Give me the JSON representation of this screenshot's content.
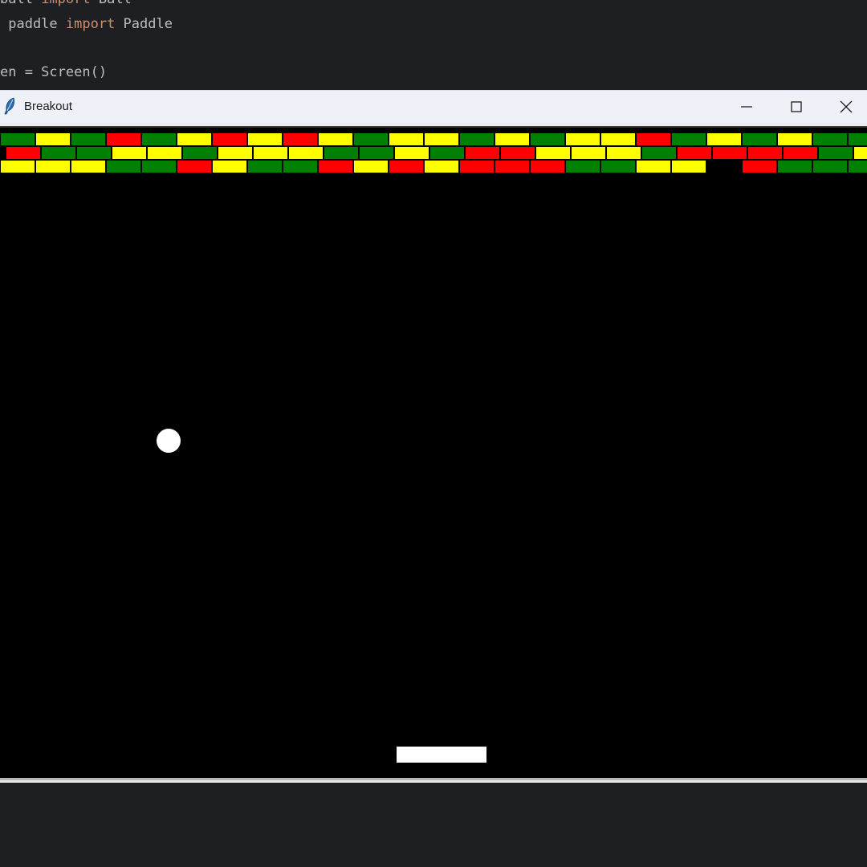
{
  "editor": {
    "lines": [
      {
        "parts": [
          {
            "text": "ball ",
            "kind": "plain"
          },
          {
            "text": "import",
            "kind": "keyword"
          },
          {
            "text": " Ball",
            "kind": "plain"
          }
        ]
      },
      {
        "parts": [
          {
            "text": " paddle ",
            "kind": "plain"
          },
          {
            "text": "import",
            "kind": "keyword"
          },
          {
            "text": " Paddle",
            "kind": "plain"
          }
        ]
      },
      {
        "parts": [
          {
            "text": "en = Screen()",
            "kind": "plain"
          }
        ]
      }
    ]
  },
  "window": {
    "title": "Breakout",
    "app_icon": "feather-icon",
    "buttons": [
      "minimize-icon",
      "maximize-icon",
      "close-icon"
    ]
  },
  "colors": {
    "green": "#008000",
    "yellow": "#ffff00",
    "red": "#ff0000",
    "canvas_bg": "#000000",
    "ball": "#ffffff",
    "paddle": "#ffffff",
    "brick_border": "#000000"
  },
  "game": {
    "brick_rows": [
      {
        "offset_half_brick": false,
        "bricks": [
          "G",
          "Y",
          "G",
          "R",
          "G",
          "Y",
          "R",
          "Y",
          "R",
          "Y",
          "G",
          "Y",
          "Y",
          "G",
          "Y",
          "G",
          "Y",
          "Y",
          "R",
          "G",
          "Y",
          "G",
          "Y",
          "G",
          "G"
        ]
      },
      {
        "offset_half_brick": true,
        "bricks": [
          "R",
          "G",
          "G",
          "Y",
          "Y",
          "G",
          "Y",
          "Y",
          "Y",
          "G",
          "G",
          "Y",
          "G",
          "R",
          "R",
          "Y",
          "Y",
          "Y",
          "G",
          "R",
          "R",
          "R",
          "R",
          "G",
          "Y"
        ]
      },
      {
        "offset_half_brick": false,
        "bricks": [
          "Y",
          "Y",
          "Y",
          "G",
          "G",
          "R",
          "Y",
          "G",
          "G",
          "R",
          "Y",
          "R",
          "Y",
          "R",
          "R",
          "R",
          "G",
          "G",
          "Y",
          "Y",
          null,
          "R",
          "G",
          "G",
          "G"
        ]
      }
    ]
  }
}
